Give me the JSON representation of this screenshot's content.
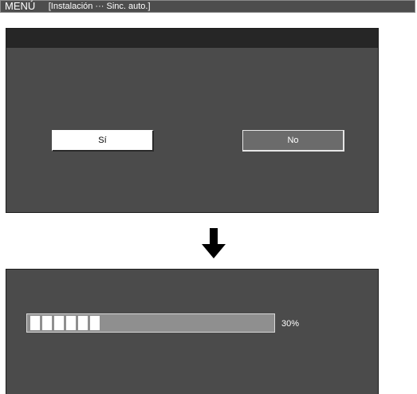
{
  "menu": {
    "title": "MENÚ",
    "breadcrumb": "[Instalación ··· Sinc. auto.]"
  },
  "dialog": {
    "yes_label": "Sí",
    "no_label": "No"
  },
  "progress": {
    "value_percent": 30,
    "label": "30%"
  },
  "icons": {
    "arrow": "down-arrow-icon"
  },
  "colors": {
    "panel": "#4b4b4b",
    "header": "#262626",
    "menu_bar": "#4d4d4d",
    "track": "#8f8f8f",
    "fill": "#ffffff"
  }
}
